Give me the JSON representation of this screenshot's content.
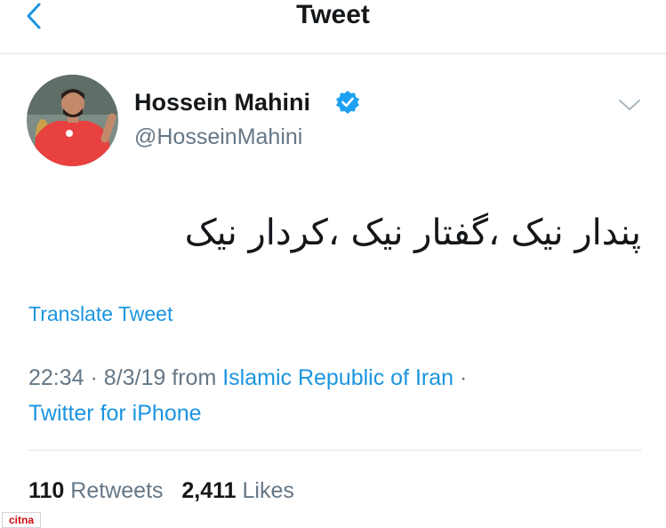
{
  "header": {
    "title": "Tweet"
  },
  "tweet": {
    "display_name": "Hossein Mahini",
    "handle": "@HosseinMahini",
    "text": "پندار نیک ،گفتار نیک ،کردار نیک",
    "translate_label": "Translate Tweet",
    "time": "22:34",
    "date": "8/3/19",
    "from_label": "from",
    "location": "Islamic Republic of Iran",
    "source": "Twitter for iPhone",
    "separator": "·"
  },
  "stats": {
    "retweets_count": "110",
    "retweets_label": "Retweets",
    "likes_count": "2,411",
    "likes_label": "Likes"
  },
  "watermark": {
    "text": "citna"
  },
  "icons": {
    "back": "chevron-left-icon",
    "verified": "verified-badge-icon",
    "caret": "chevron-down-icon"
  },
  "colors": {
    "accent": "#1b95e0",
    "muted": "#657786",
    "text": "#14171a",
    "divider": "#e1e8ed"
  }
}
